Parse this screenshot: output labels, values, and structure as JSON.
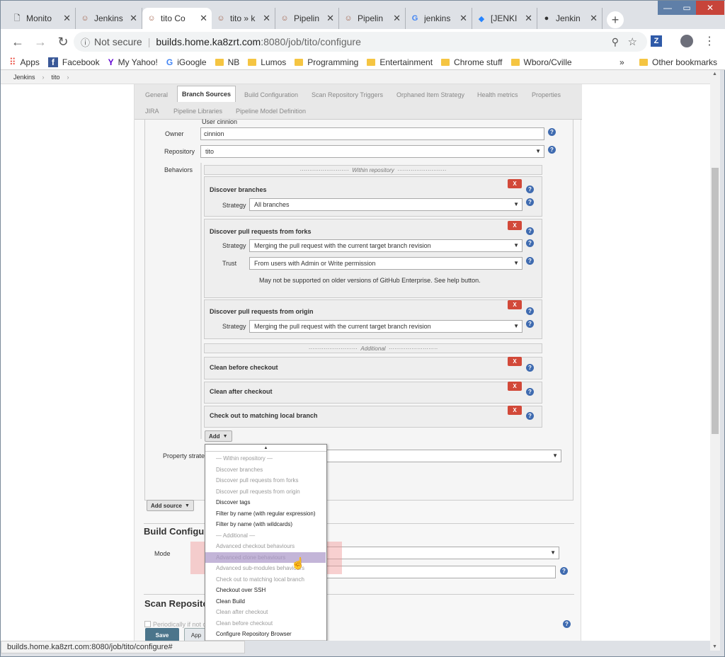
{
  "tabs": [
    {
      "label": "Monito",
      "icon": "page-icon"
    },
    {
      "label": "Jenkins",
      "icon": "jenkins-icon"
    },
    {
      "label": "tito Co",
      "icon": "jenkins-icon"
    },
    {
      "label": "tito » k",
      "icon": "jenkins-icon"
    },
    {
      "label": "Pipelin",
      "icon": "jenkins-icon"
    },
    {
      "label": "Pipelin",
      "icon": "jenkins-icon"
    },
    {
      "label": "jenkins",
      "icon": "google-icon"
    },
    {
      "label": "[JENKI",
      "icon": "jira-icon"
    },
    {
      "label": "Jenkin",
      "icon": "github-icon"
    }
  ],
  "address": {
    "security": "Not secure",
    "host": "builds.home.ka8zrt.com",
    "path": ":8080/job/tito/configure"
  },
  "bookmarks": [
    "Apps",
    "Facebook",
    "My Yahoo!",
    "iGoogle",
    "NB",
    "Lumos",
    "Programming",
    "Entertainment",
    "Chrome stuff",
    "Wboro/Cville"
  ],
  "bookmarks_more": "»",
  "other_bookmarks": "Other bookmarks",
  "breadcrumb": [
    "Jenkins",
    "›",
    "tito",
    "›"
  ],
  "config_tabs_row1": [
    "General",
    "Branch Sources",
    "Build Configuration",
    "Scan Repository Triggers",
    "Orphaned Item Strategy",
    "Health metrics",
    "Properties"
  ],
  "config_tabs_row2": [
    "JIRA",
    "Pipeline Libraries",
    "Pipeline Model Definition"
  ],
  "form": {
    "user_note": "User cinnion",
    "owner_label": "Owner",
    "owner_value": "cinnion",
    "repo_label": "Repository",
    "repo_value": "tito",
    "behaviors_label": "Behaviors",
    "within_repo": "Within repository",
    "discover_branches": "Discover branches",
    "strategy_label": "Strategy",
    "all_branches": "All branches",
    "discover_forks": "Discover pull requests from forks",
    "merging": "Merging the pull request with the current target branch revision",
    "trust_label": "Trust",
    "trust_value": "From users with Admin or Write permission",
    "fork_note": "May not be supported on older versions of GitHub Enterprise. See help button.",
    "discover_origin": "Discover pull requests from origin",
    "additional": "Additional",
    "clean_before": "Clean before checkout",
    "clean_after": "Clean after checkout",
    "checkout_local": "Check out to matching local branch",
    "add": "Add",
    "property_label": "Property strateg",
    "add_source": "Add source",
    "x": "X",
    "help": "?"
  },
  "sections": {
    "build_config": "Build Configu",
    "mode_label": "Mode",
    "scan_repo": "Scan Reposito",
    "periodically": "Periodically if not o",
    "save": "Save",
    "apply": "App"
  },
  "dropdown": {
    "up": "▲",
    "down": "▼",
    "items": [
      {
        "label": "— Within repository —",
        "enabled": false
      },
      {
        "label": "Discover branches",
        "enabled": false
      },
      {
        "label": "Discover pull requests from forks",
        "enabled": false
      },
      {
        "label": "Discover pull requests from origin",
        "enabled": false
      },
      {
        "label": "Discover tags",
        "enabled": true
      },
      {
        "label": "Filter by name (with regular expression)",
        "enabled": true
      },
      {
        "label": "Filter by name (with wildcards)",
        "enabled": true
      },
      {
        "label": "— Additional —",
        "enabled": false
      },
      {
        "label": "Advanced checkout behaviours",
        "enabled": false
      },
      {
        "label": "Advanced clone behaviours",
        "enabled": false
      },
      {
        "label": "Advanced sub-modules behaviours",
        "enabled": false
      },
      {
        "label": "Check out to matching local branch",
        "enabled": false
      },
      {
        "label": "Checkout over SSH",
        "enabled": true
      },
      {
        "label": "Clean Build",
        "enabled": true
      },
      {
        "label": "Clean after checkout",
        "enabled": false
      },
      {
        "label": "Clean before checkout",
        "enabled": false
      },
      {
        "label": "Configure Repository Browser",
        "enabled": true
      }
    ]
  },
  "status_bar": "builds.home.ka8zrt.com:8080/job/tito/configure#"
}
